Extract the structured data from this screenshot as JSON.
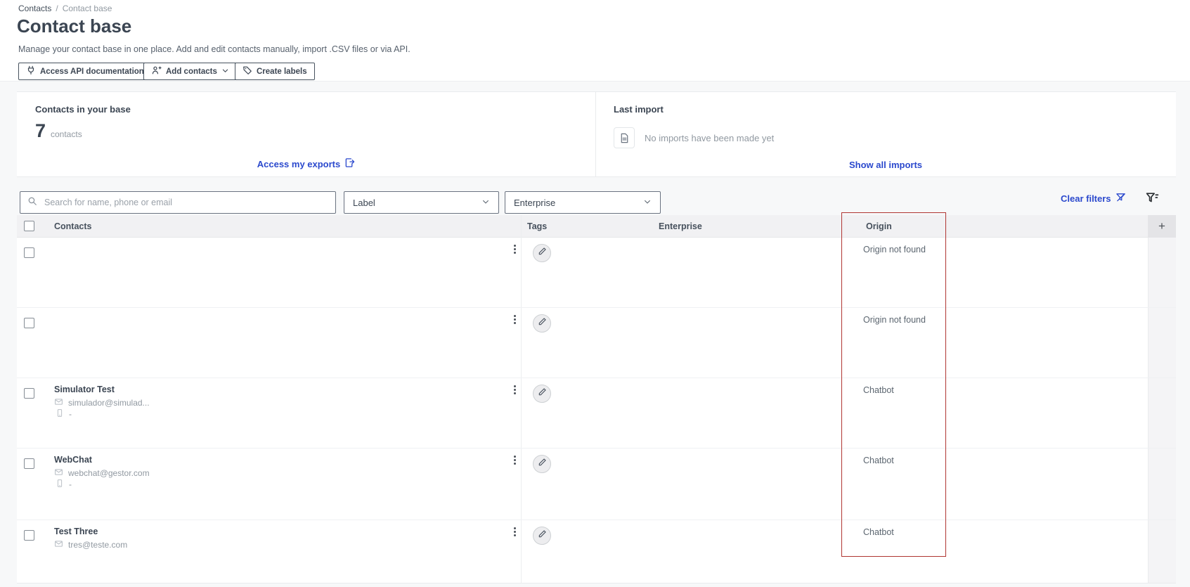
{
  "breadcrumb": {
    "root": "Contacts",
    "separator": "/",
    "current": "Contact base"
  },
  "header": {
    "title": "Contact base",
    "subtitle": "Manage your contact base in one place. Add and edit contacts manually, import .CSV files or via API.",
    "buttons": {
      "api": "Access API documentation",
      "add_contacts": "Add contacts",
      "create_labels": "Create labels"
    }
  },
  "cards": {
    "contacts": {
      "title": "Contacts in your base",
      "count": "7",
      "unit": "contacts",
      "link": "Access my exports"
    },
    "last_import": {
      "title": "Last import",
      "empty_message": "No imports have been made yet",
      "link": "Show all imports"
    }
  },
  "filters": {
    "search_placeholder": "Search for name, phone or email",
    "label_dropdown": "Label",
    "enterprise_dropdown": "Enterprise",
    "clear_label": "Clear filters"
  },
  "table": {
    "columns": {
      "contacts": "Contacts",
      "tags": "Tags",
      "enterprise": "Enterprise",
      "origin": "Origin"
    },
    "add_column_label": "+",
    "rows": [
      {
        "origin": "Origin not found"
      },
      {
        "origin": "Origin not found"
      },
      {
        "name": "Simulator Test",
        "email": "simulador@simulad...",
        "phone": "-",
        "origin": "Chatbot"
      },
      {
        "name": "WebChat",
        "email": "webchat@gestor.com",
        "phone": "-",
        "origin": "Chatbot"
      },
      {
        "name": "Test Three",
        "email": "tres@teste.com",
        "origin": "Chatbot"
      }
    ]
  },
  "colors": {
    "accent_blue": "#2b49cd",
    "highlight_red": "#b03532",
    "page_background": "#f7f8f9"
  }
}
